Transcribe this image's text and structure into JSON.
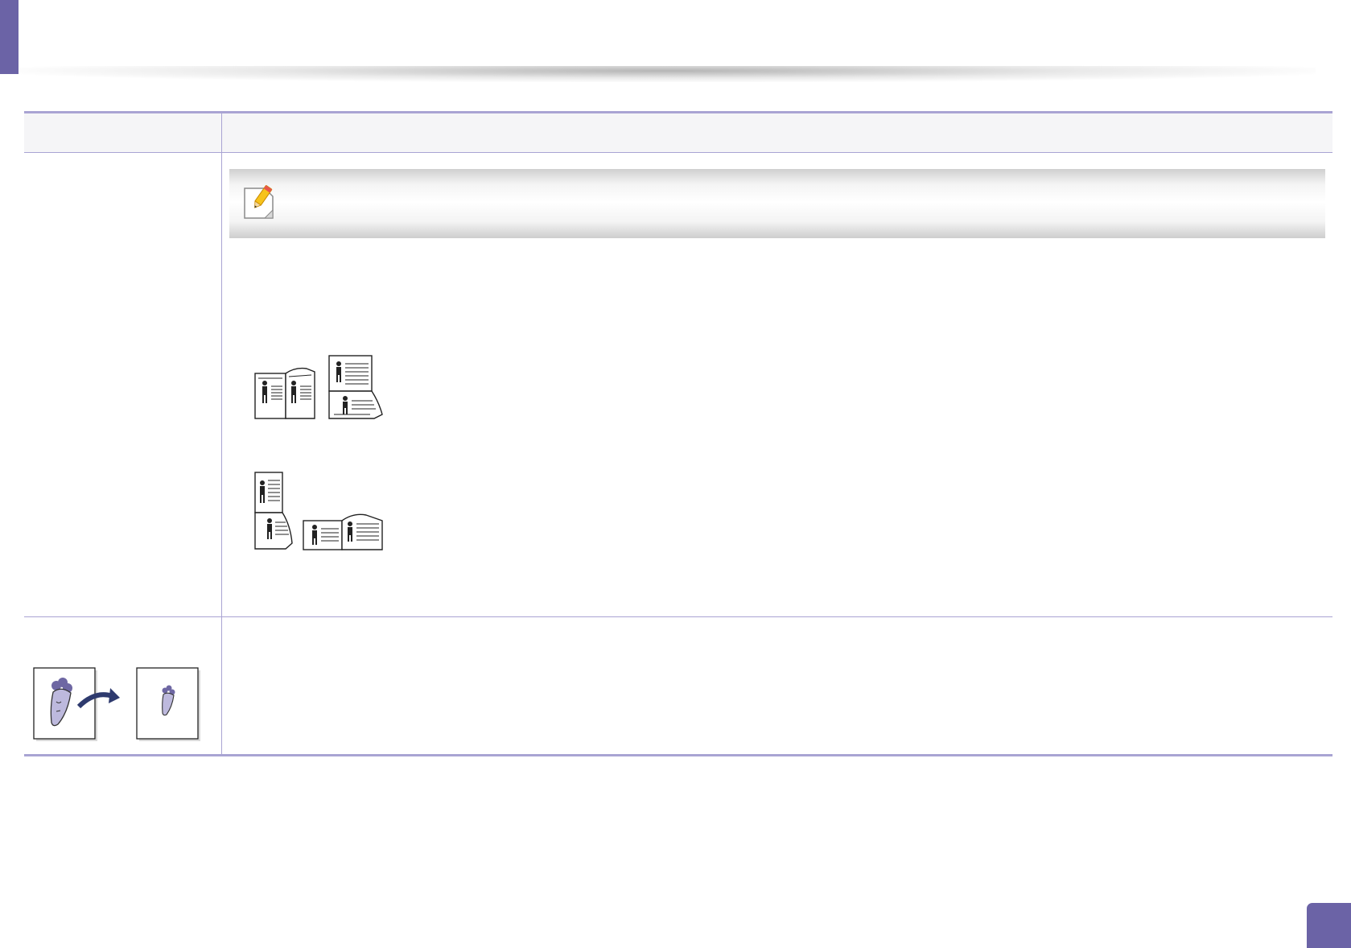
{
  "page": {
    "accent_color": "#6b63a6",
    "rule_color": "#a9a4d3"
  },
  "table": {
    "header": {
      "column_1": "",
      "column_2": ""
    },
    "rows": [
      {
        "note": {
          "icon": "note-pencil-icon",
          "text": ""
        },
        "illustrations": [
          "double-sided-long-edge-icon",
          "double-sided-short-edge-icon"
        ]
      },
      {
        "illustrations": [
          "reduce-enlarge-icon"
        ]
      }
    ]
  }
}
